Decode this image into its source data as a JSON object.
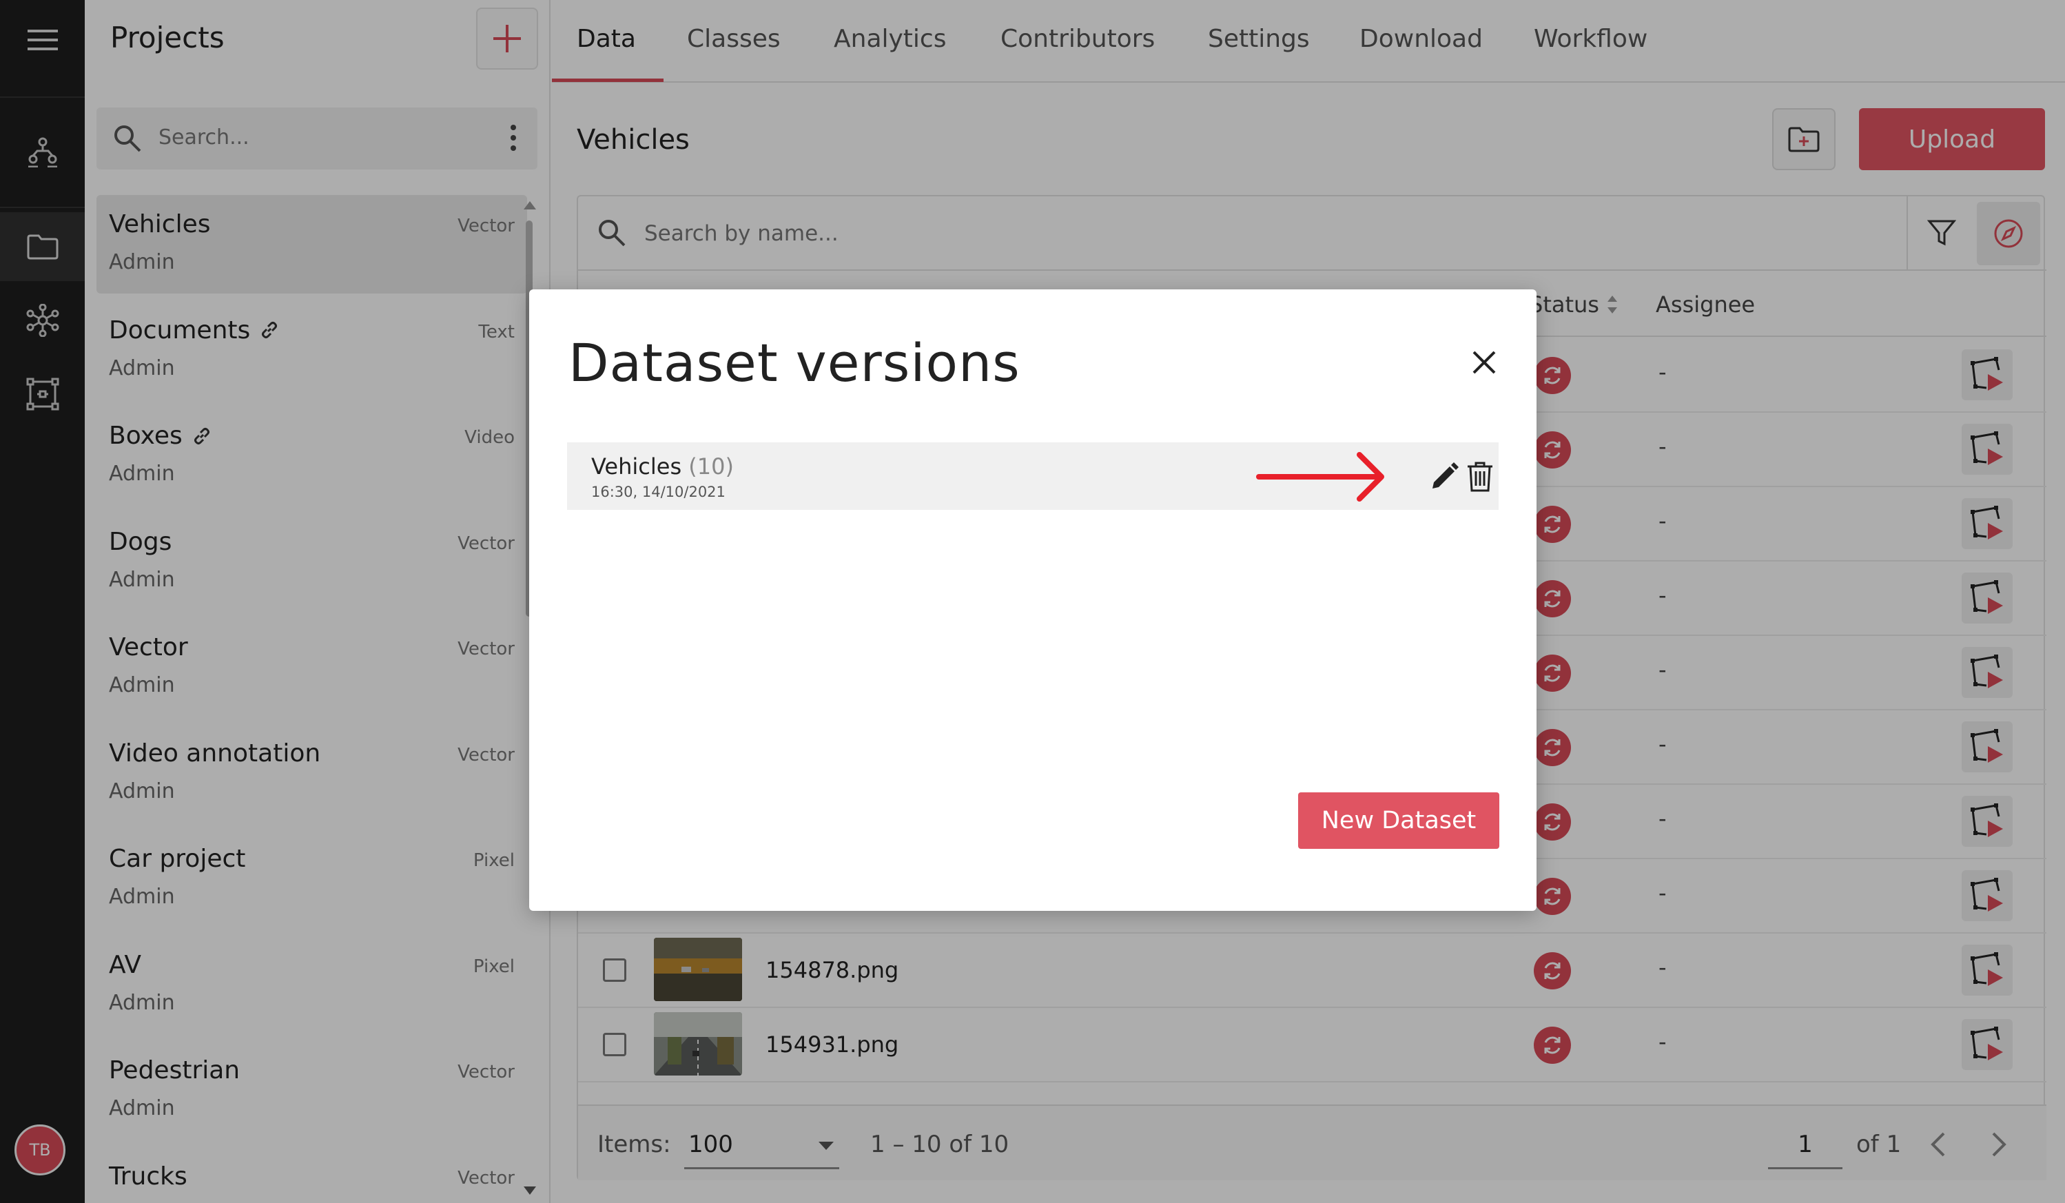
{
  "rail": {
    "avatar_initials": "TB",
    "icons": [
      "menu-icon",
      "team-icon",
      "folder-icon",
      "neural-network-icon",
      "grid-nodes-icon"
    ]
  },
  "projects": {
    "title": "Projects",
    "search_placeholder": "Search...",
    "items": [
      {
        "name": "Vehicles",
        "type": "Vector",
        "owner": "Admin",
        "linked": false
      },
      {
        "name": "Documents",
        "type": "Text",
        "owner": "Admin",
        "linked": true
      },
      {
        "name": "Boxes",
        "type": "Video",
        "owner": "Admin",
        "linked": true
      },
      {
        "name": "Dogs",
        "type": "Vector",
        "owner": "Admin",
        "linked": false
      },
      {
        "name": "Vector",
        "type": "Vector",
        "owner": "Admin",
        "linked": false
      },
      {
        "name": "Video annotation",
        "type": "Vector",
        "owner": "Admin",
        "linked": false
      },
      {
        "name": "Car project",
        "type": "Pixel",
        "owner": "Admin",
        "linked": false
      },
      {
        "name": "AV",
        "type": "Pixel",
        "owner": "Admin",
        "linked": false
      },
      {
        "name": "Pedestrian",
        "type": "Vector",
        "owner": "Admin",
        "linked": false
      },
      {
        "name": "Trucks",
        "type": "Vector",
        "owner": "Admin",
        "linked": false
      }
    ]
  },
  "tabs": [
    "Data",
    "Classes",
    "Analytics",
    "Contributors",
    "Settings",
    "Download",
    "Workflow"
  ],
  "main": {
    "title": "Vehicles",
    "upload_label": "Upload",
    "search_placeholder": "Search by name...",
    "col_status": "Status",
    "col_assignee": "Assignee",
    "rows": [
      {
        "file": "",
        "assignee": "-"
      },
      {
        "file": "",
        "assignee": "-"
      },
      {
        "file": "",
        "assignee": "-"
      },
      {
        "file": "",
        "assignee": "-"
      },
      {
        "file": "",
        "assignee": "-"
      },
      {
        "file": "",
        "assignee": "-"
      },
      {
        "file": "",
        "assignee": "-"
      },
      {
        "file": "",
        "assignee": "-"
      },
      {
        "file": "154878.png",
        "assignee": "-"
      },
      {
        "file": "154931.png",
        "assignee": "-"
      }
    ],
    "footer": {
      "items_label": "Items:",
      "items_value": "100",
      "range": "1 – 10 of 10",
      "page": "1",
      "of_pages": "of 1"
    }
  },
  "modal": {
    "title": "Dataset versions",
    "version": {
      "name": "Vehicles",
      "count": "(10)",
      "date": "16:30, 14/10/2021"
    },
    "new_dataset_label": "New Dataset",
    "accent": "#e05462",
    "annotation_arrow_color": "#e8202a"
  }
}
